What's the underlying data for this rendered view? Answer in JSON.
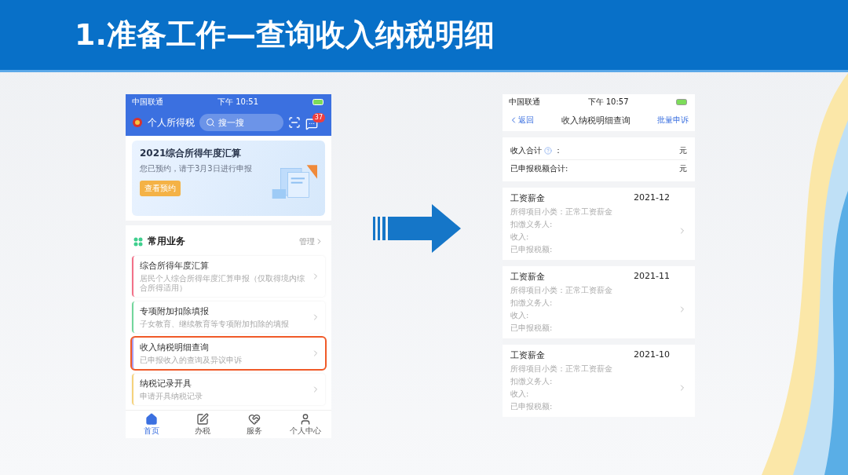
{
  "title": "1.准备工作—查询收入纳税明细",
  "left_phone": {
    "status_bar": {
      "carrier": "中国联通",
      "time": "下午 10:51"
    },
    "header": {
      "title": "个人所得税",
      "search_placeholder": "搜一搜",
      "badge": "37"
    },
    "banner": {
      "title": "2021综合所得年度汇算",
      "subtitle": "您已预约，请于3月3日进行申报",
      "button": "查看预约"
    },
    "section": {
      "title": "常用业务",
      "action": "管理"
    },
    "items": [
      {
        "title": "综合所得年度汇算",
        "subtitle": "居民个人综合所得年度汇算申报（仅取得境内综合所得适用）",
        "color": "#f27088",
        "selected": false
      },
      {
        "title": "专项附加扣除填报",
        "subtitle": "子女教育、继续教育等专项附加扣除的填报",
        "color": "#72d69c",
        "selected": false
      },
      {
        "title": "收入纳税明细查询",
        "subtitle": "已申报收入的查询及异议申诉",
        "color": "#a99cf0",
        "selected": true
      },
      {
        "title": "纳税记录开具",
        "subtitle": "申请开具纳税记录",
        "color": "#f5d27c",
        "selected": false
      }
    ],
    "tabs": [
      {
        "label": "首页",
        "kind": "home",
        "selected": true
      },
      {
        "label": "办税",
        "kind": "tax",
        "selected": false
      },
      {
        "label": "服务",
        "kind": "service",
        "selected": false
      },
      {
        "label": "个人中心",
        "kind": "user",
        "selected": false
      }
    ]
  },
  "right_phone": {
    "status_bar": {
      "carrier": "中国联通",
      "time": "下午 10:57"
    },
    "nav": {
      "back": "返回",
      "title": "收入纳税明细查询",
      "action": "批量申诉"
    },
    "summary": [
      {
        "label": "收入合计",
        "help": true,
        "colon": "：",
        "unit": "元"
      },
      {
        "label": "已申报税额合计:",
        "unit": "元"
      }
    ],
    "records": [
      {
        "title": "工资薪金",
        "date": "2021-12",
        "lines": [
          "所得项目小类：正常工资薪金",
          "扣缴义务人:",
          "收入:",
          "已申报税额:"
        ]
      },
      {
        "title": "工资薪金",
        "date": "2021-11",
        "lines": [
          "所得项目小类：正常工资薪金",
          "扣缴义务人:",
          "收入:",
          "已申报税额:"
        ]
      },
      {
        "title": "工资薪金",
        "date": "2021-10",
        "lines": [
          "所得项目小类：正常工资薪金",
          "扣缴义务人:",
          "收入:",
          "已申报税额:"
        ]
      }
    ]
  }
}
